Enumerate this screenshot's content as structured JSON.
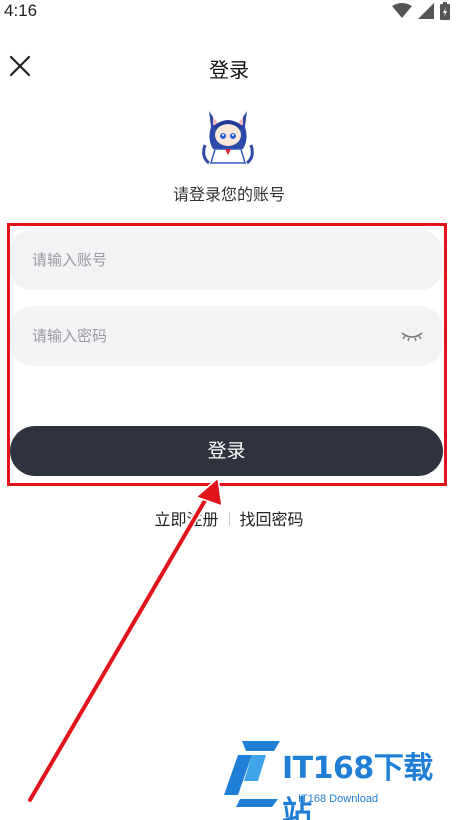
{
  "status_bar": {
    "time": "4:16"
  },
  "header": {
    "title": "登录",
    "close_icon": "close-icon"
  },
  "subtitle": "请登录您的账号",
  "form": {
    "account_placeholder": "请输入账号",
    "password_placeholder": "请输入密码",
    "login_label": "登录"
  },
  "links": {
    "register": "立即注册",
    "forgot": "找回密码"
  },
  "watermark": {
    "brand": "IT168下载站",
    "sub": "IT168 Download"
  },
  "colors": {
    "button": "#2f3340",
    "annotation": "#e1141c",
    "field_bg": "#f3f3f5",
    "watermark": "#1f7fd6"
  }
}
